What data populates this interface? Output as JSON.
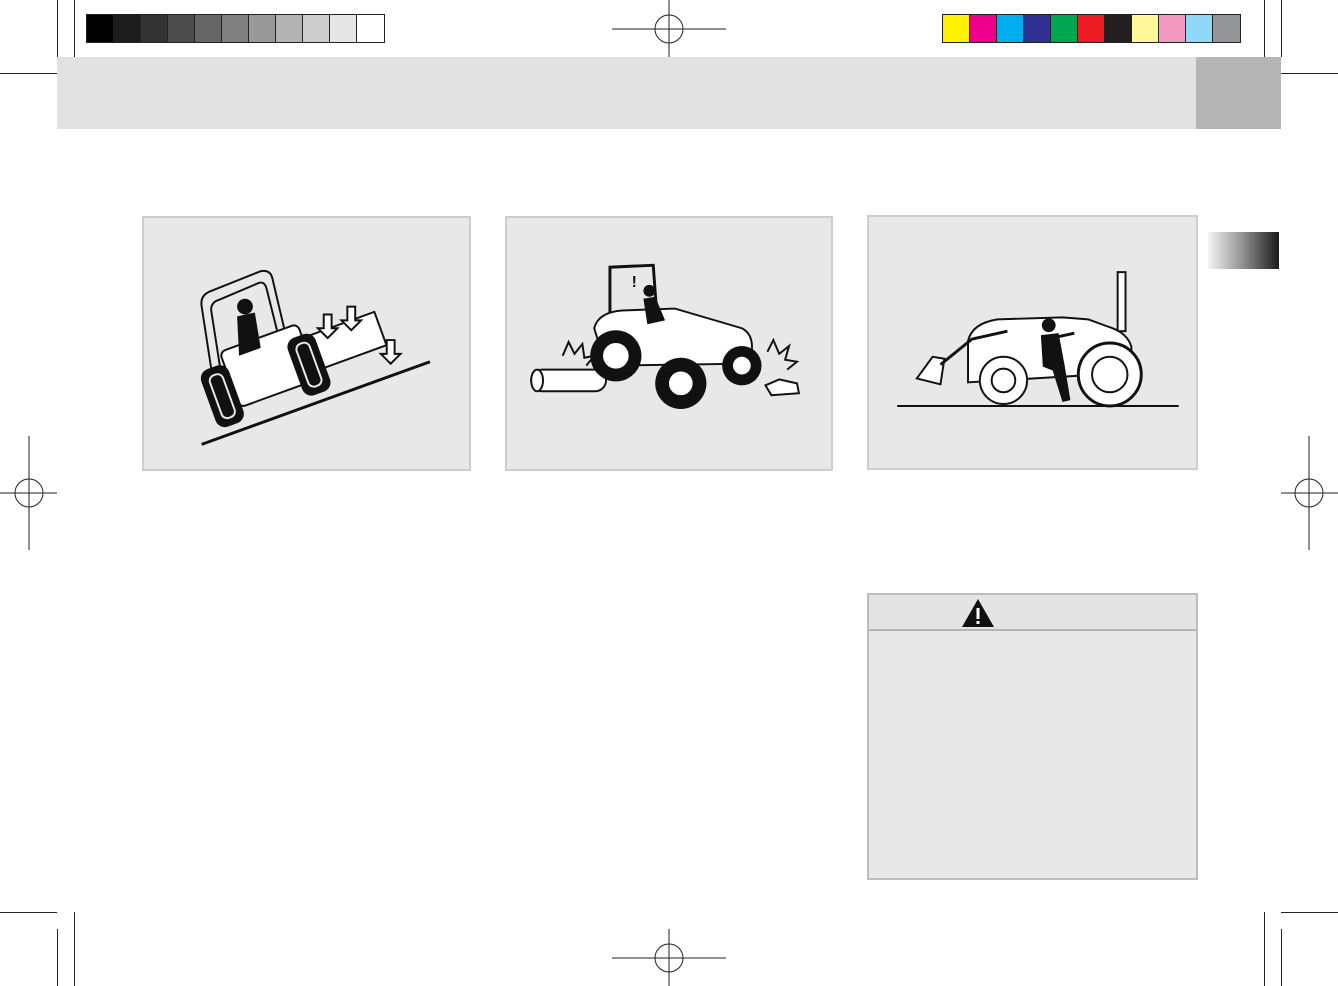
{
  "print_marks": {
    "grayscale_bar": [
      "#000000",
      "#1c1c1c",
      "#333333",
      "#4c4c4c",
      "#666666",
      "#808080",
      "#999999",
      "#b3b3b3",
      "#cccccc",
      "#e6e6e6",
      "#ffffff"
    ],
    "color_bar": [
      "#fff200",
      "#ec008c",
      "#00aeef",
      "#2e3192",
      "#00a651",
      "#ed1c24",
      "#231f20",
      "#fff799",
      "#f49ac1",
      "#8ed8f8",
      "#939598"
    ]
  },
  "header": {
    "band_color": "#e1e1e1",
    "tab_color": "#b5b5b5"
  },
  "figures": [
    {
      "icon": "tractor-on-slope-icon"
    },
    {
      "icon": "tractor-hitting-obstacles-icon"
    },
    {
      "icon": "operator-mounting-tractor-icon"
    }
  ],
  "warning": {
    "icon": "warning-triangle-icon",
    "body_text": ""
  }
}
